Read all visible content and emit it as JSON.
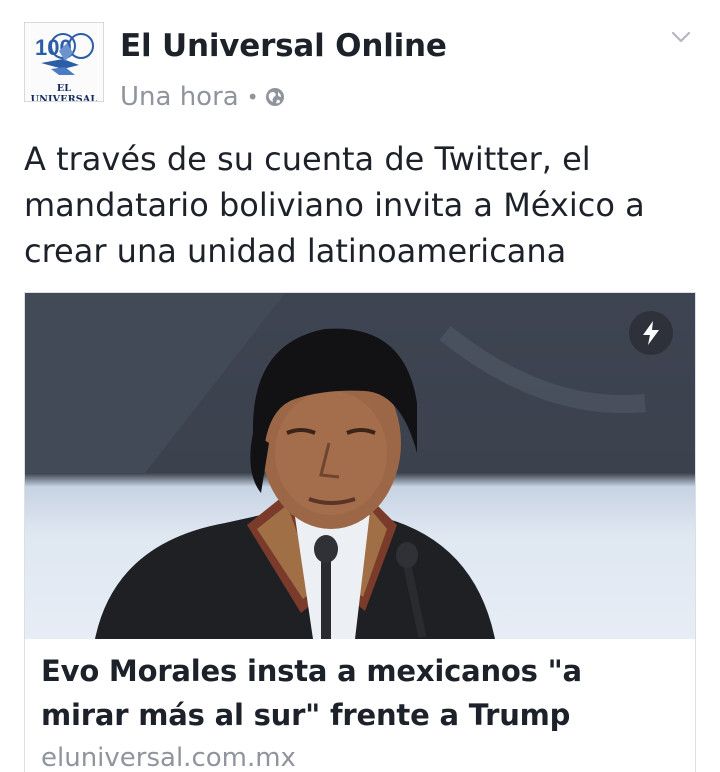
{
  "post": {
    "page_name": "El Universal Online",
    "timestamp": "Una hora",
    "separator": "•",
    "privacy_icon": "globe-icon",
    "menu_icon": "chevron-down-icon",
    "avatar": {
      "logo_number": "100",
      "logo_text": "EL UNIVERSAL"
    },
    "text": "A través de su cuenta de Twitter, el mandatario boliviano invita a México a crear una unidad latinoamericana"
  },
  "link_card": {
    "badge_icon": "lightning-bolt-icon",
    "title": "Evo Morales insta a mexicanos \"a mirar más al sur\" frente a Trump",
    "domain": "eluniversal.com.mx"
  },
  "colors": {
    "text_primary": "#1d2129",
    "text_secondary": "#90949c",
    "border": "#dddfe2"
  }
}
